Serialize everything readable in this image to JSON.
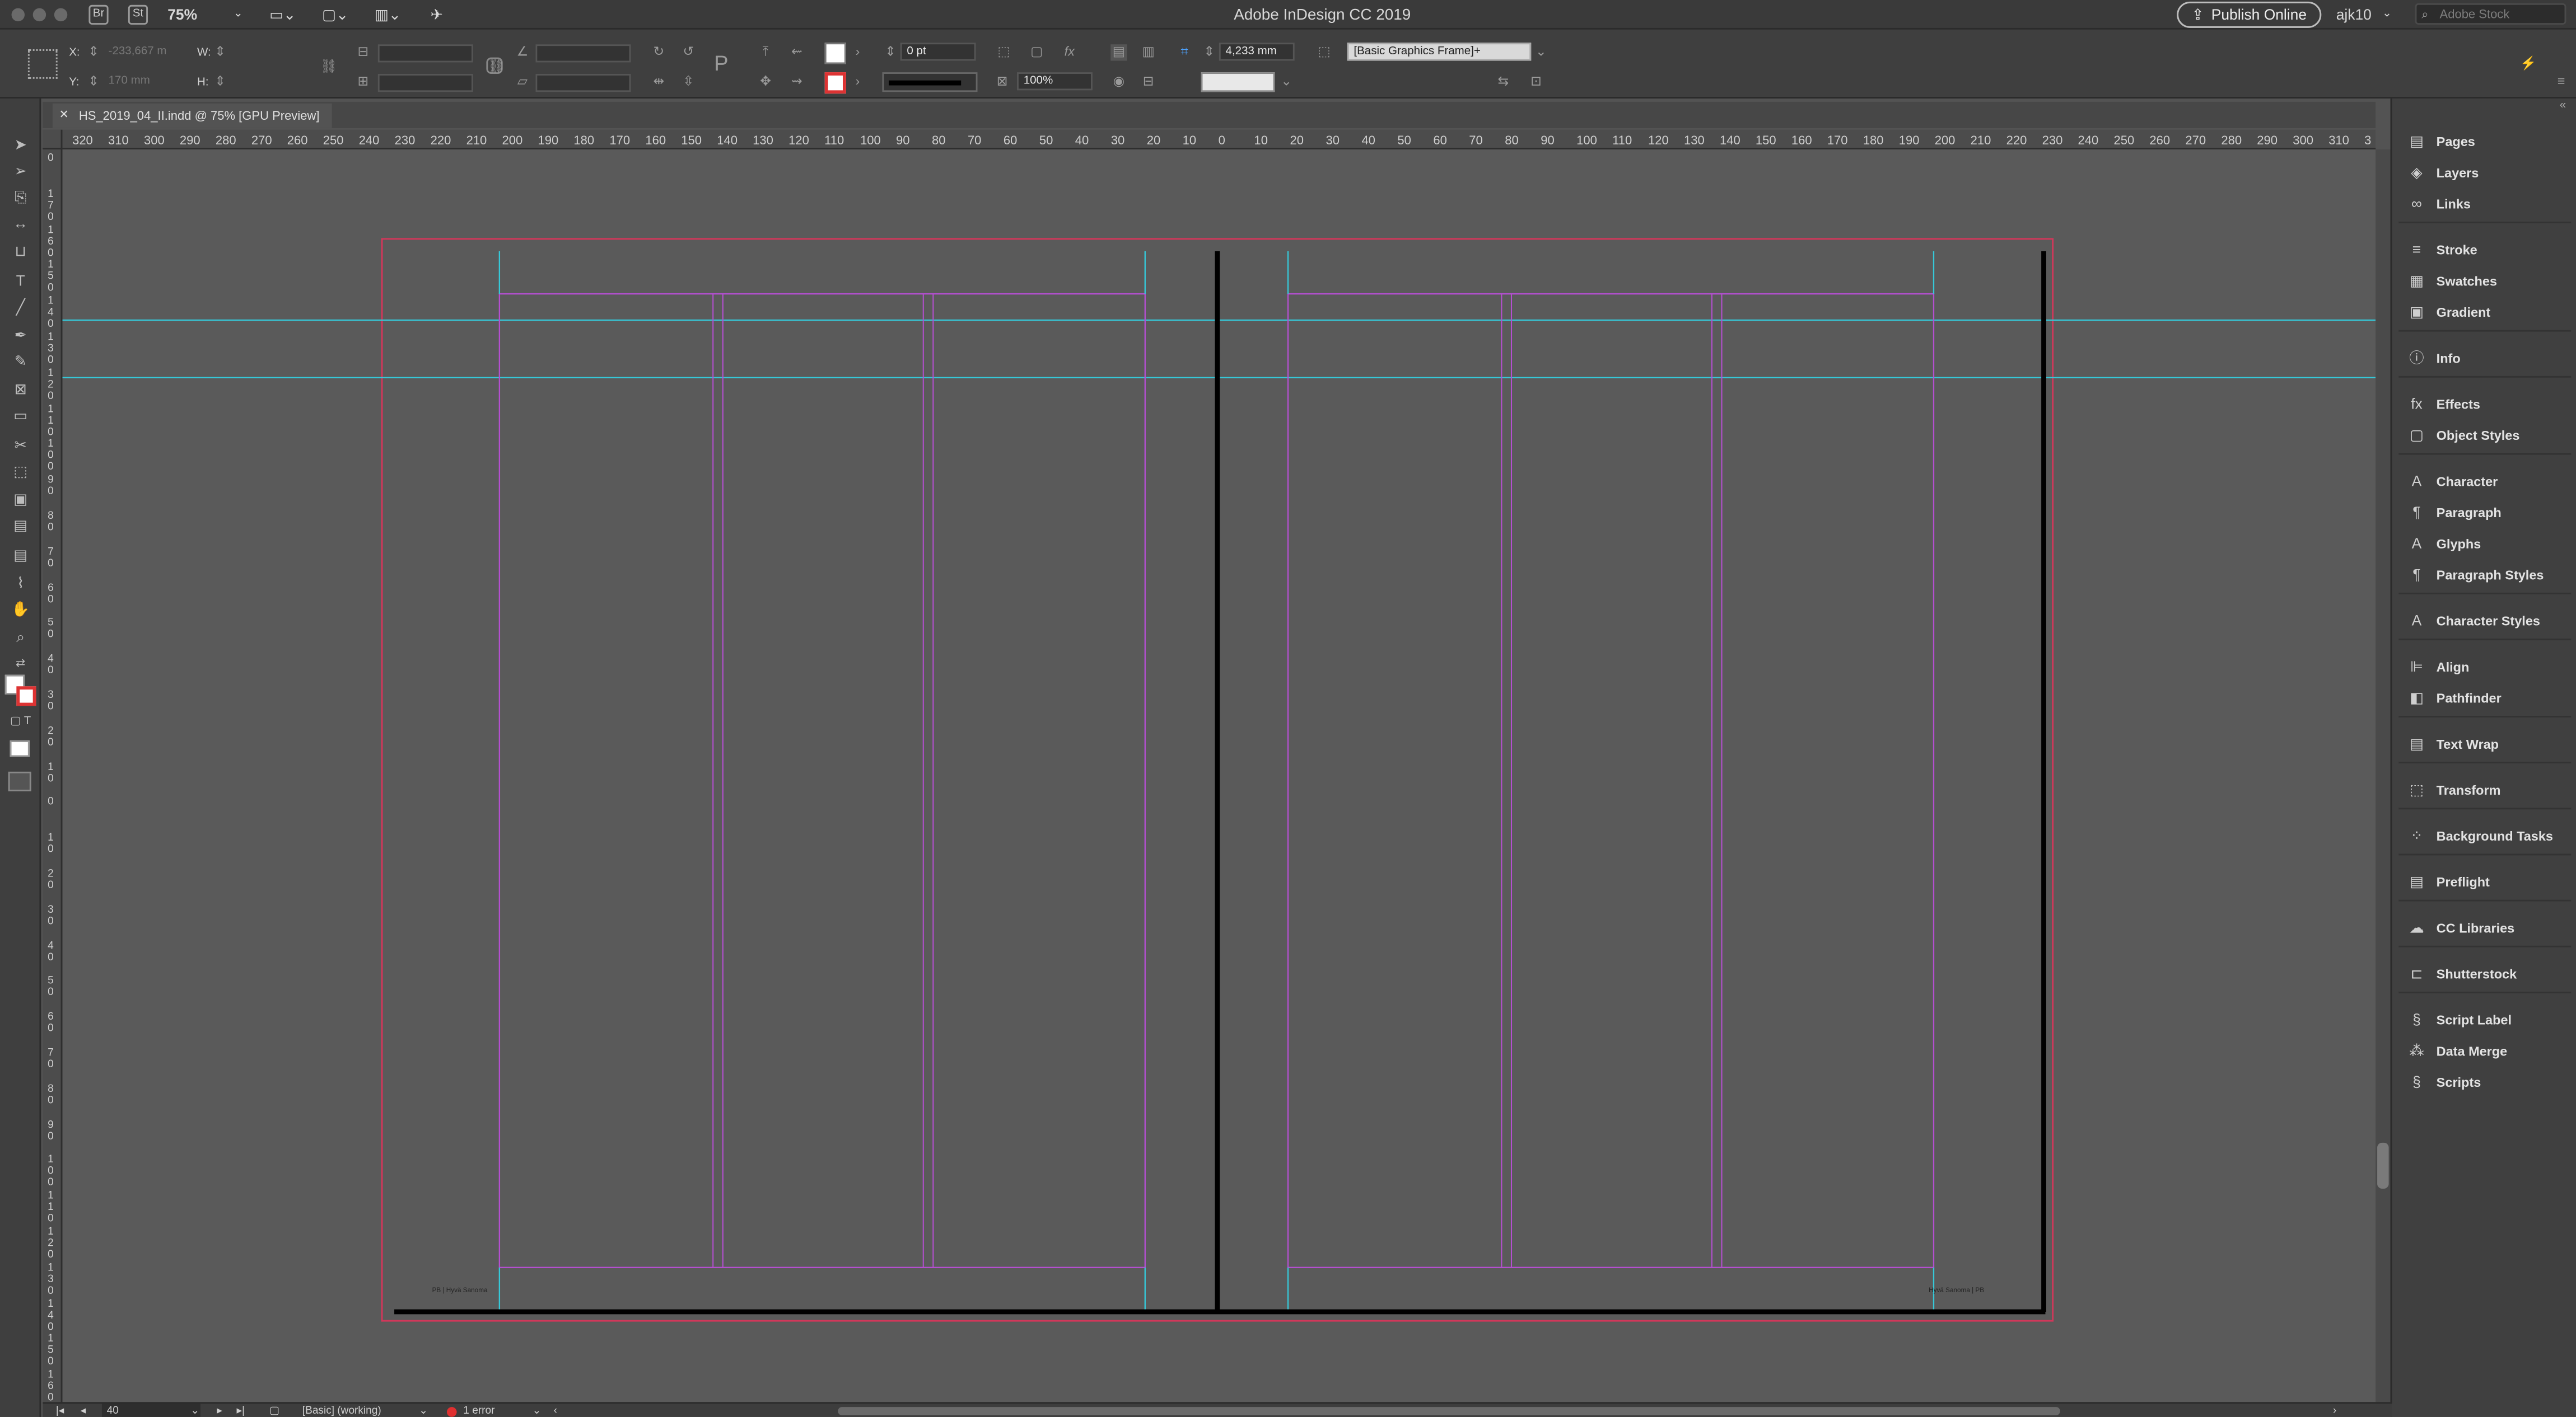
{
  "app": {
    "title": "Adobe InDesign CC 2019",
    "zoom": "75%",
    "publish_label": "Publish Online",
    "user": "ajk10",
    "stock_placeholder": "Adobe Stock",
    "bridge_badge": "Br",
    "stock_badge": "St"
  },
  "control": {
    "x_label": "X:",
    "x_value": "-233,667 m",
    "y_label": "Y:",
    "y_value": "170 mm",
    "w_label": "W:",
    "h_label": "H:",
    "stroke_weight": "0 pt",
    "opacity": "100%",
    "measure": "4,233 mm",
    "object_style": "[Basic Graphics Frame]+"
  },
  "document": {
    "tab_title": "HS_2019_04_II.indd @ 75% [GPU Preview]",
    "footer_left": "PB | Hyvä Sanoma",
    "footer_right": "Hyvä Sanoma | PB"
  },
  "rulers": {
    "h": [
      "320",
      "310",
      "300",
      "290",
      "280",
      "270",
      "260",
      "250",
      "240",
      "230",
      "220",
      "210",
      "200",
      "190",
      "180",
      "170",
      "160",
      "150",
      "140",
      "130",
      "120",
      "110",
      "100",
      "90",
      "80",
      "70",
      "60",
      "50",
      "40",
      "30",
      "20",
      "10",
      "0",
      "10",
      "20",
      "30",
      "40",
      "50",
      "60",
      "70",
      "80",
      "90",
      "100",
      "110",
      "120",
      "130",
      "140",
      "150",
      "160",
      "170",
      "180",
      "190",
      "200",
      "210",
      "220",
      "230",
      "240",
      "250",
      "260",
      "270",
      "280",
      "290",
      "300",
      "310",
      "3"
    ],
    "v": [
      "0",
      "170",
      "160",
      "150",
      "140",
      "130",
      "120",
      "110",
      "100",
      "90",
      "80",
      "70",
      "60",
      "50",
      "40",
      "30",
      "20",
      "10",
      "0",
      "10",
      "20",
      "30",
      "40",
      "50",
      "60",
      "70",
      "80",
      "90",
      "100",
      "110",
      "120",
      "130",
      "140",
      "150",
      "160"
    ]
  },
  "panels": [
    {
      "label": "Pages",
      "icon": "pages-icon",
      "glyph": "▤"
    },
    {
      "label": "Layers",
      "icon": "layers-icon",
      "glyph": "◈"
    },
    {
      "label": "Links",
      "icon": "links-icon",
      "glyph": "∞"
    },
    {
      "label": "Stroke",
      "icon": "stroke-icon",
      "glyph": "≡"
    },
    {
      "label": "Swatches",
      "icon": "swatches-icon",
      "glyph": "▦"
    },
    {
      "label": "Gradient",
      "icon": "gradient-icon",
      "glyph": "▣"
    },
    {
      "label": "Info",
      "icon": "info-icon",
      "glyph": "ⓘ"
    },
    {
      "label": "Effects",
      "icon": "effects-icon",
      "glyph": "fx"
    },
    {
      "label": "Object Styles",
      "icon": "object-styles-icon",
      "glyph": "▢"
    },
    {
      "label": "Character",
      "icon": "character-icon",
      "glyph": "A"
    },
    {
      "label": "Paragraph",
      "icon": "paragraph-icon",
      "glyph": "¶"
    },
    {
      "label": "Glyphs",
      "icon": "glyphs-icon",
      "glyph": "A"
    },
    {
      "label": "Paragraph Styles",
      "icon": "paragraph-styles-icon",
      "glyph": "¶"
    },
    {
      "label": "Character Styles",
      "icon": "character-styles-icon",
      "glyph": "A"
    },
    {
      "label": "Align",
      "icon": "align-icon",
      "glyph": "⊫"
    },
    {
      "label": "Pathfinder",
      "icon": "pathfinder-icon",
      "glyph": "◧"
    },
    {
      "label": "Text Wrap",
      "icon": "text-wrap-icon",
      "glyph": "▤"
    },
    {
      "label": "Transform",
      "icon": "transform-icon",
      "glyph": "⬚"
    },
    {
      "label": "Background Tasks",
      "icon": "background-tasks-icon",
      "glyph": "⁘"
    },
    {
      "label": "Preflight",
      "icon": "preflight-icon",
      "glyph": "▤"
    },
    {
      "label": "CC Libraries",
      "icon": "cc-libraries-icon",
      "glyph": "☁"
    },
    {
      "label": "Shutterstock",
      "icon": "shutterstock-icon",
      "glyph": "⊏"
    },
    {
      "label": "Script Label",
      "icon": "script-label-icon",
      "glyph": "§"
    },
    {
      "label": "Data Merge",
      "icon": "data-merge-icon",
      "glyph": "⁂"
    },
    {
      "label": "Scripts",
      "icon": "scripts-icon",
      "glyph": "§"
    }
  ],
  "status": {
    "page": "40",
    "master": "[Basic] (working)",
    "errors": "1 error"
  },
  "colors": {
    "bleed": "#d0385a",
    "margin": "#b44fd0",
    "guide": "#36c8d8",
    "page_edge": "#000000"
  }
}
